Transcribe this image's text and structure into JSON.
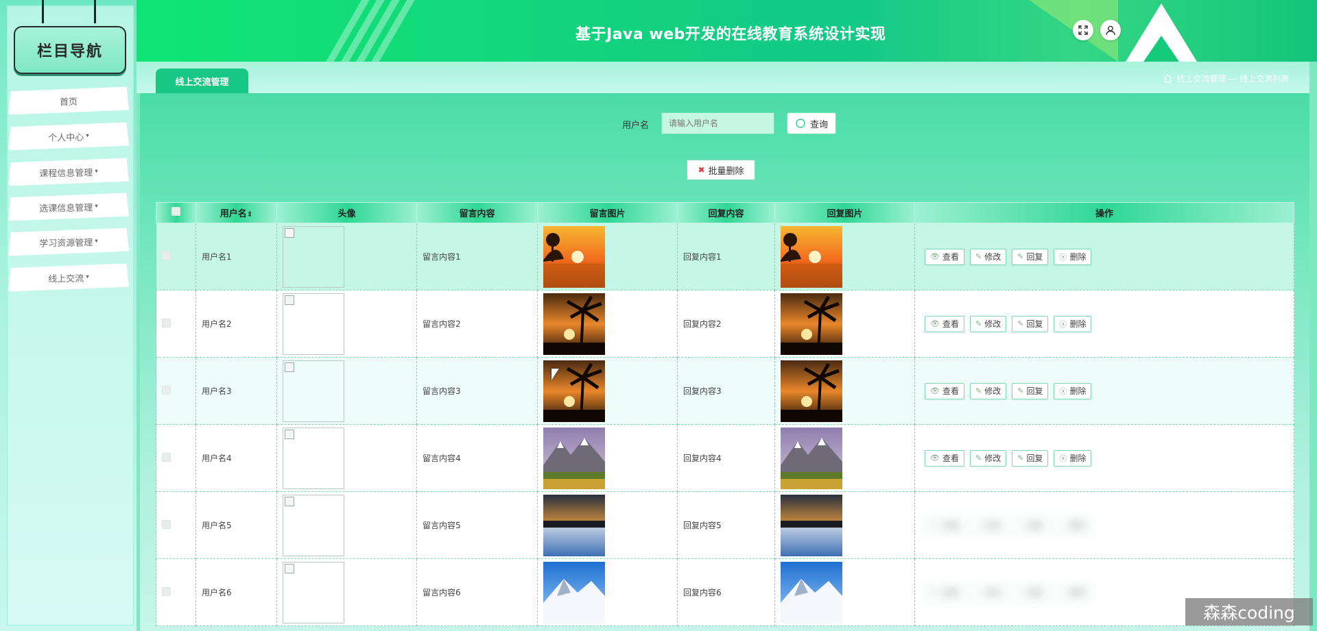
{
  "app": {
    "title": "基于Java web开发的在线教育系统设计实现"
  },
  "sidebar": {
    "heading": "栏目导航",
    "items": [
      {
        "label": "首页",
        "has_caret": false
      },
      {
        "label": "个人中心",
        "has_caret": true
      },
      {
        "label": "课程信息管理",
        "has_caret": true
      },
      {
        "label": "选课信息管理",
        "has_caret": true
      },
      {
        "label": "学习资源管理",
        "has_caret": true
      },
      {
        "label": "线上交流",
        "has_caret": true
      }
    ],
    "caret": "▾"
  },
  "header": {
    "fullscreen_icon": "expand-icon",
    "user_icon": "user-icon"
  },
  "tabbar": {
    "active_tab": "线上交流管理",
    "breadcrumb": {
      "home_icon": "home-icon",
      "path": "线上交流管理 — 线上交流列表"
    }
  },
  "search": {
    "label": "用户名",
    "placeholder": "请输入用户名",
    "button_label": "查询"
  },
  "batch_delete": {
    "label": "批量删除"
  },
  "table": {
    "columns": [
      "用户名",
      "头像",
      "留言内容",
      "留言图片",
      "回复内容",
      "回复图片",
      "操作"
    ],
    "sort_indicator": "⇕",
    "actions": [
      {
        "label": "查看",
        "icon": "eye-icon"
      },
      {
        "label": "修改",
        "icon": "edit-icon"
      },
      {
        "label": "回复",
        "icon": "reply-icon"
      },
      {
        "label": "删除",
        "icon": "delete-icon"
      }
    ],
    "rows": [
      {
        "username": "用户名1",
        "message": "留言内容1",
        "reply": "回复内容1",
        "image": "sunset-lake"
      },
      {
        "username": "用户名2",
        "message": "留言内容2",
        "reply": "回复内容2",
        "image": "palm-sunset"
      },
      {
        "username": "用户名3",
        "message": "留言内容3",
        "reply": "回复内容3",
        "image": "palm-sunset"
      },
      {
        "username": "用户名4",
        "message": "留言内容4",
        "reply": "回复内容4",
        "image": "mountain-valley"
      },
      {
        "username": "用户名5",
        "message": "留言内容5",
        "reply": "回复内容5",
        "image": "frozen-lake"
      },
      {
        "username": "用户名6",
        "message": "留言内容6",
        "reply": "回复内容6",
        "image": "snow-mountain"
      }
    ]
  },
  "watermark": "森森coding",
  "colors": {
    "accent": "#17c883",
    "header_start": "#0fe574",
    "header_end": "#11c57b",
    "delete_red": "#e03b3b"
  }
}
